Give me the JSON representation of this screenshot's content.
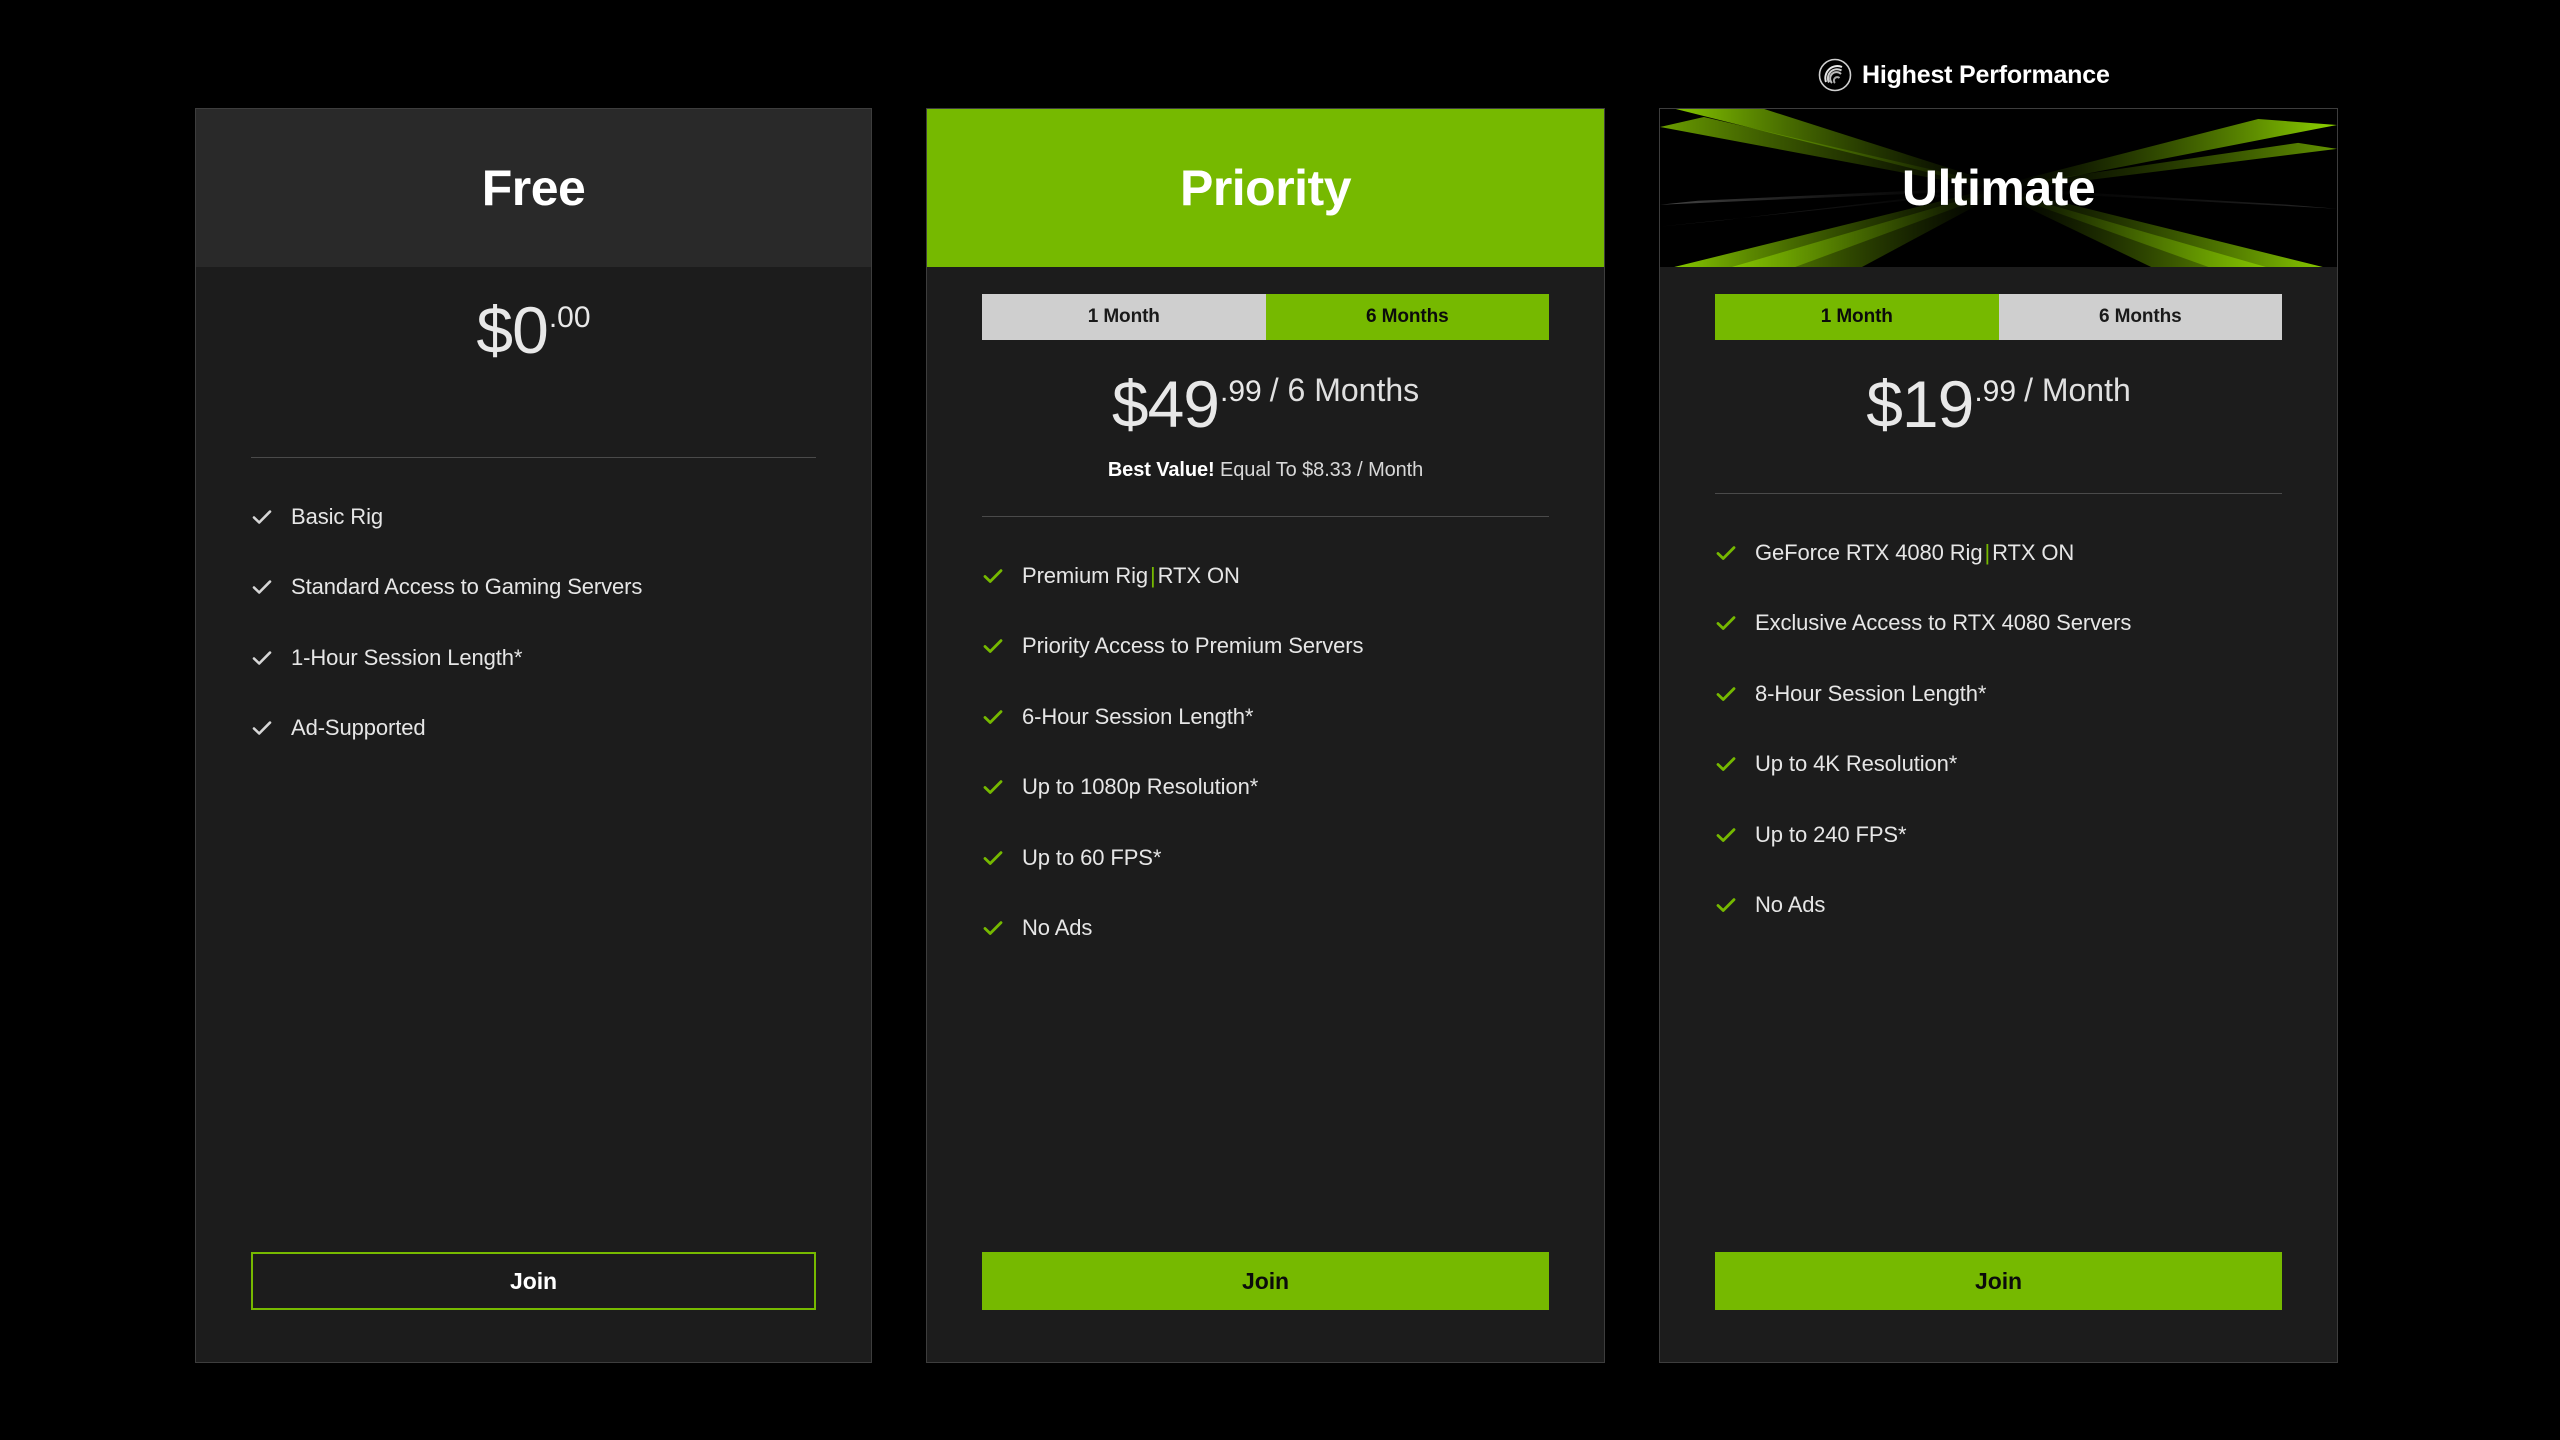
{
  "badge": {
    "label": "Highest Performance",
    "icon": "performance-gauge-icon"
  },
  "colors": {
    "accent_green": "#76b900",
    "page_background": "#000000",
    "card_background": "#1c1c1c",
    "free_header_background": "#292929",
    "toggle_inactive": "#cfcfcf"
  },
  "plans": [
    {
      "id": "free",
      "title": "Free",
      "price": {
        "main": "$0",
        "cents": ".00",
        "period": ""
      },
      "note": "",
      "features": [
        {
          "text": "Basic Rig"
        },
        {
          "text": "Standard Access to Gaming Servers"
        },
        {
          "text": "1-Hour Session Length*"
        },
        {
          "text": "Ad-Supported"
        }
      ],
      "cta": "Join"
    },
    {
      "id": "priority",
      "title": "Priority",
      "toggle": {
        "options": [
          "1 Month",
          "6 Months"
        ],
        "selected": "6 Months"
      },
      "price": {
        "main": "$49",
        "cents": ".99",
        "period": "/ 6 Months"
      },
      "note_bold": "Best Value!",
      "note": "Equal To $8.33 / Month",
      "features": [
        {
          "text": "Premium Rig",
          "separator": "|",
          "text2": "RTX ON"
        },
        {
          "text": "Priority Access to Premium Servers"
        },
        {
          "text": "6-Hour Session Length*"
        },
        {
          "text": "Up to 1080p Resolution*"
        },
        {
          "text": "Up to 60 FPS*"
        },
        {
          "text": "No Ads"
        }
      ],
      "cta": "Join"
    },
    {
      "id": "ultimate",
      "title": "Ultimate",
      "toggle": {
        "options": [
          "1 Month",
          "6 Months"
        ],
        "selected": "1 Month"
      },
      "price": {
        "main": "$19",
        "cents": ".99",
        "period": "/ Month"
      },
      "note_bold": "",
      "note": "",
      "features": [
        {
          "text": "GeForce RTX 4080 Rig",
          "separator": "|",
          "text2": "RTX ON"
        },
        {
          "text": "Exclusive Access to RTX 4080 Servers"
        },
        {
          "text": "8-Hour Session Length*"
        },
        {
          "text": "Up to 4K Resolution*"
        },
        {
          "text": "Up to 240 FPS*"
        },
        {
          "text": "No Ads"
        }
      ],
      "cta": "Join"
    }
  ]
}
